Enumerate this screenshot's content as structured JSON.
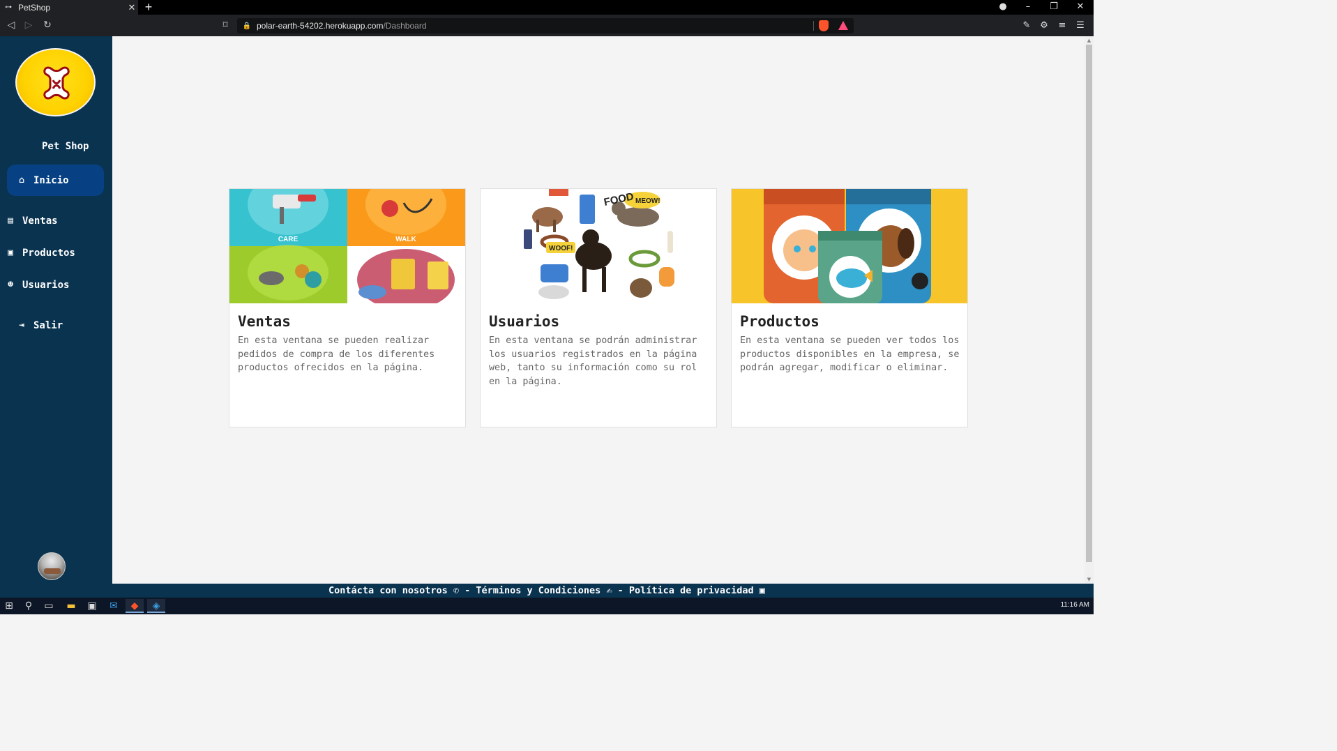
{
  "browser": {
    "tab_title": "PetShop",
    "new_tab": "+",
    "url_host": "polar-earth-54202.herokuapp.com",
    "url_path": "/Dashboard"
  },
  "sidebar": {
    "brand": "Pet Shop",
    "items": [
      {
        "label": "Inicio",
        "icon": "home-icon",
        "active": true
      },
      {
        "label": "Ventas",
        "icon": "cash-register-icon"
      },
      {
        "label": "Productos",
        "icon": "shopping-bag-icon"
      },
      {
        "label": "Usuarios",
        "icon": "users-icon"
      },
      {
        "label": "Salir",
        "icon": "sign-out-icon"
      }
    ]
  },
  "cards": [
    {
      "title": "Ventas",
      "text": "En esta ventana se pueden realizar pedidos de compra de los diferentes productos ofrecidos en la página.",
      "image_labels": [
        "CARE",
        "WALK"
      ]
    },
    {
      "title": "Usuarios",
      "text": "En esta ventana se podrán administrar los usuarios registrados en la página web, tanto su información como su rol en la página.",
      "image_labels": [
        "FOOD",
        "MEOW!",
        "WOOF!"
      ]
    },
    {
      "title": "Productos",
      "text": "En esta ventana se pueden ver todos los productos disponibles en la empresa, se podrán agregar, modificar o eliminar."
    }
  ],
  "footer": {
    "contact": "Contácta con nosotros",
    "sep1": " - ",
    "terms": "Términos y Condiciones",
    "sep2": " - ",
    "privacy": "Política de privacidad"
  },
  "taskbar": {
    "clock": "11:16 AM"
  },
  "colors": {
    "sidebar_bg": "#0a3350",
    "active_item_bg": "#074183",
    "logo_yellow": "#ffd100",
    "content_bg": "#f4f4f4"
  }
}
